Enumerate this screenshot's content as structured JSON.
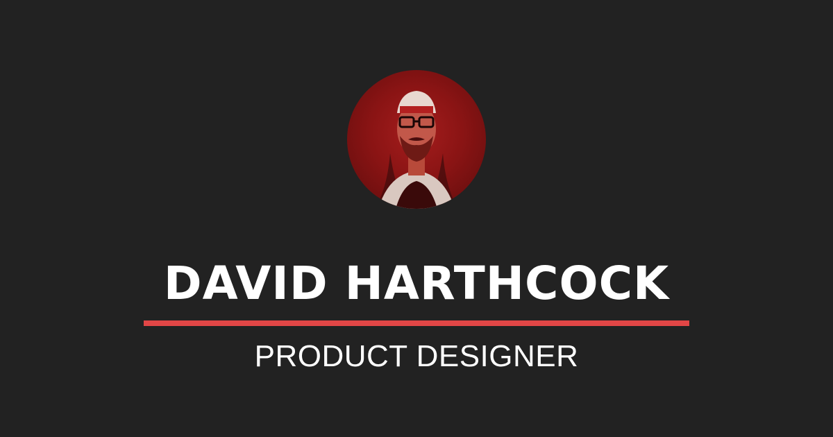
{
  "profile": {
    "name": "DAVID HARTHCOCK",
    "title": "PRODUCT DESIGNER",
    "avatar_icon": "portrait-photo"
  },
  "colors": {
    "background": "#222222",
    "accent": "#e14646",
    "text": "#ffffff",
    "avatar_tint": "#a51d1d"
  }
}
